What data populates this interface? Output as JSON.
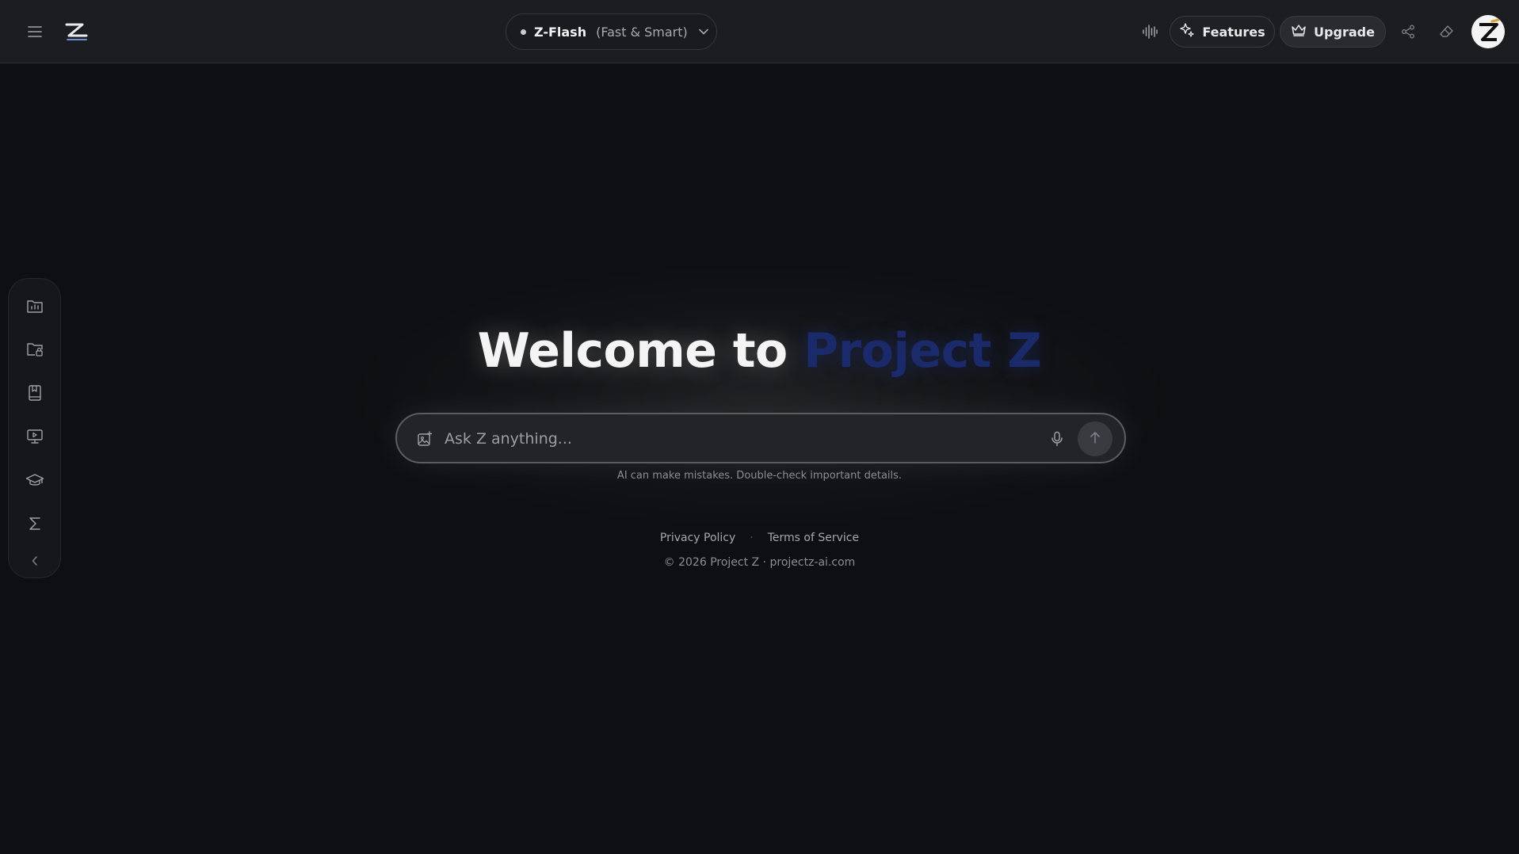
{
  "header": {
    "model": {
      "name": "Z-Flash",
      "description": "(Fast & Smart)"
    },
    "features_label": "Features",
    "upgrade_label": "Upgrade",
    "icons": {
      "menu": "hamburger-menu-icon",
      "logo": "project-z-logo",
      "voice": "voice-waveform-icon",
      "share": "share-icon",
      "erase": "eraser-icon"
    }
  },
  "sidebar": {
    "items": [
      {
        "icon": "analytics-folder-icon"
      },
      {
        "icon": "locked-folder-icon"
      },
      {
        "icon": "bookmark-book-icon"
      },
      {
        "icon": "presentation-icon"
      },
      {
        "icon": "graduation-cap-icon"
      },
      {
        "icon": "sigma-icon"
      }
    ],
    "collapse_icon": "chevron-left-icon"
  },
  "main": {
    "welcome_prefix": "Welcome to ",
    "welcome_brand": "Project Z",
    "input_placeholder": "Ask Z anything...",
    "disclaimer": "AI can make mistakes. Double-check important details."
  },
  "footer": {
    "privacy": "Privacy Policy",
    "separator": "·",
    "terms": "Terms of Service",
    "copyright": "© 2026 Project Z · projectz-ai.com"
  },
  "colors": {
    "background": "#0e0f12",
    "topbar": "#1c1d21",
    "brand_blue": "#1b2a6b"
  }
}
